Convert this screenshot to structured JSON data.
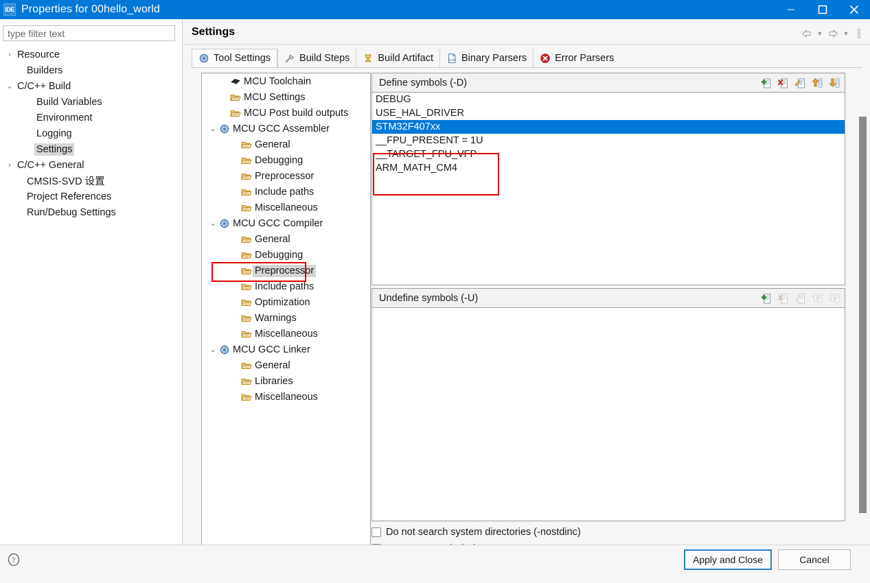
{
  "window": {
    "title": "Properties for 00hello_world",
    "app_icon_label": "IDE",
    "minimize_icon": "minimize-icon",
    "maximize_icon": "maximize-icon",
    "close_icon": "close-icon",
    "titlebar_color": "#0078d7"
  },
  "sidebar": {
    "filter": {
      "value": "",
      "placeholder": "type filter text"
    },
    "items": [
      {
        "label": "Resource",
        "indent": 0,
        "arrow": "collapsed",
        "selected": false
      },
      {
        "label": "Builders",
        "indent": 1,
        "arrow": "none",
        "selected": false
      },
      {
        "label": "C/C++ Build",
        "indent": 0,
        "arrow": "expanded",
        "selected": false
      },
      {
        "label": "Build Variables",
        "indent": 2,
        "arrow": "none",
        "selected": false
      },
      {
        "label": "Environment",
        "indent": 2,
        "arrow": "none",
        "selected": false
      },
      {
        "label": "Logging",
        "indent": 2,
        "arrow": "none",
        "selected": false
      },
      {
        "label": "Settings",
        "indent": 2,
        "arrow": "none",
        "selected": true
      },
      {
        "label": "C/C++ General",
        "indent": 0,
        "arrow": "collapsed",
        "selected": false
      },
      {
        "label": "CMSIS-SVD 设置",
        "indent": 1,
        "arrow": "none",
        "selected": false
      },
      {
        "label": "Project References",
        "indent": 1,
        "arrow": "none",
        "selected": false
      },
      {
        "label": "Run/Debug Settings",
        "indent": 1,
        "arrow": "none",
        "selected": false
      }
    ]
  },
  "header": {
    "title": "Settings",
    "back_icon": "back-arrow-icon",
    "back_caret_icon": "chevron-down-icon",
    "forward_icon": "forward-arrow-icon",
    "forward_caret_icon": "chevron-down-icon",
    "menu_icon": "vertical-dots-menu-icon"
  },
  "tabs": [
    {
      "label": "Tool Settings",
      "icon": "tool-settings-icon",
      "active": true
    },
    {
      "label": "Build Steps",
      "icon": "build-steps-icon",
      "active": false
    },
    {
      "label": "Build Artifact",
      "icon": "build-artifact-icon",
      "active": false
    },
    {
      "label": "Binary Parsers",
      "icon": "binary-parsers-icon",
      "active": false
    },
    {
      "label": "Error Parsers",
      "icon": "error-parsers-icon",
      "active": false
    }
  ],
  "tool_tree": [
    {
      "label": "MCU Toolchain",
      "indent": 1,
      "arrow": "none",
      "icon": "chip-icon",
      "selected": false,
      "highlight": false
    },
    {
      "label": "MCU Settings",
      "indent": 1,
      "arrow": "none",
      "icon": "folder-icon",
      "selected": false,
      "highlight": false
    },
    {
      "label": "MCU Post build outputs",
      "indent": 1,
      "arrow": "none",
      "icon": "folder-icon",
      "selected": false,
      "highlight": false
    },
    {
      "label": "MCU GCC Assembler",
      "indent": 0,
      "arrow": "expanded",
      "icon": "gear-globe-icon",
      "selected": false,
      "highlight": false
    },
    {
      "label": "General",
      "indent": 2,
      "arrow": "none",
      "icon": "folder-icon",
      "selected": false,
      "highlight": false
    },
    {
      "label": "Debugging",
      "indent": 2,
      "arrow": "none",
      "icon": "folder-icon",
      "selected": false,
      "highlight": false
    },
    {
      "label": "Preprocessor",
      "indent": 2,
      "arrow": "none",
      "icon": "folder-icon",
      "selected": false,
      "highlight": false
    },
    {
      "label": "Include paths",
      "indent": 2,
      "arrow": "none",
      "icon": "folder-icon",
      "selected": false,
      "highlight": false
    },
    {
      "label": "Miscellaneous",
      "indent": 2,
      "arrow": "none",
      "icon": "folder-icon",
      "selected": false,
      "highlight": false
    },
    {
      "label": "MCU GCC Compiler",
      "indent": 0,
      "arrow": "expanded",
      "icon": "gear-globe-icon",
      "selected": false,
      "highlight": false
    },
    {
      "label": "General",
      "indent": 2,
      "arrow": "none",
      "icon": "folder-icon",
      "selected": false,
      "highlight": false
    },
    {
      "label": "Debugging",
      "indent": 2,
      "arrow": "none",
      "icon": "folder-icon",
      "selected": false,
      "highlight": false
    },
    {
      "label": "Preprocessor",
      "indent": 2,
      "arrow": "none",
      "icon": "folder-icon",
      "selected": true,
      "highlight": true
    },
    {
      "label": "Include paths",
      "indent": 2,
      "arrow": "none",
      "icon": "folder-icon",
      "selected": false,
      "highlight": false
    },
    {
      "label": "Optimization",
      "indent": 2,
      "arrow": "none",
      "icon": "folder-icon",
      "selected": false,
      "highlight": false
    },
    {
      "label": "Warnings",
      "indent": 2,
      "arrow": "none",
      "icon": "folder-icon",
      "selected": false,
      "highlight": false
    },
    {
      "label": "Miscellaneous",
      "indent": 2,
      "arrow": "none",
      "icon": "folder-icon",
      "selected": false,
      "highlight": false
    },
    {
      "label": "MCU GCC Linker",
      "indent": 0,
      "arrow": "expanded",
      "icon": "gear-globe-icon",
      "selected": false,
      "highlight": false
    },
    {
      "label": "General",
      "indent": 2,
      "arrow": "none",
      "icon": "folder-icon",
      "selected": false,
      "highlight": false
    },
    {
      "label": "Libraries",
      "indent": 2,
      "arrow": "none",
      "icon": "folder-icon",
      "selected": false,
      "highlight": false
    },
    {
      "label": "Miscellaneous",
      "indent": 2,
      "arrow": "none",
      "icon": "folder-icon",
      "selected": false,
      "highlight": false
    }
  ],
  "define_symbols": {
    "title": "Define symbols (-D)",
    "tools": [
      {
        "name": "add-icon",
        "enabled": true
      },
      {
        "name": "delete-icon",
        "enabled": true
      },
      {
        "name": "edit-icon",
        "enabled": true
      },
      {
        "name": "move-up-icon",
        "enabled": true
      },
      {
        "name": "move-down-icon",
        "enabled": true
      }
    ],
    "items": [
      {
        "text": "DEBUG",
        "selected": false
      },
      {
        "text": "USE_HAL_DRIVER",
        "selected": false
      },
      {
        "text": "STM32F407xx",
        "selected": true
      },
      {
        "text": "__FPU_PRESENT = 1U",
        "selected": false
      },
      {
        "text": "__TARGET_FPU_VFP",
        "selected": false
      },
      {
        "text": "ARM_MATH_CM4",
        "selected": false
      }
    ],
    "highlight_color": "#e00000",
    "selection_color": "#0078d7"
  },
  "undefine_symbols": {
    "title": "Undefine symbols (-U)",
    "tools": [
      {
        "name": "add-icon",
        "enabled": true
      },
      {
        "name": "delete-icon",
        "enabled": false
      },
      {
        "name": "edit-icon",
        "enabled": false
      },
      {
        "name": "move-up-icon",
        "enabled": false
      },
      {
        "name": "move-down-icon",
        "enabled": false
      }
    ],
    "items": []
  },
  "checkboxes": [
    {
      "label": "Do not search system directories (-nostdinc)",
      "checked": false
    },
    {
      "label": "Preprocess only (-E)",
      "checked": false
    }
  ],
  "footer": {
    "help_icon": "help-icon",
    "apply_label": "Apply and Close",
    "cancel_label": "Cancel"
  }
}
